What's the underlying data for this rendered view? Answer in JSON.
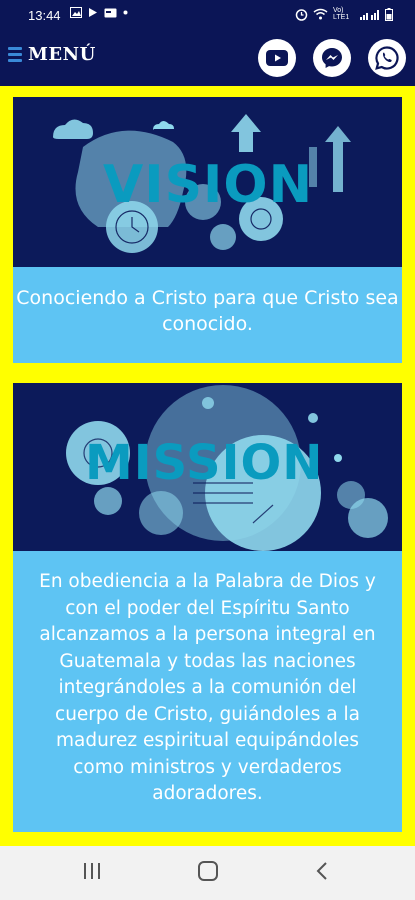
{
  "status_bar": {
    "time": "13:44",
    "signal_text": "Vo) LTE1"
  },
  "app_bar": {
    "menu_label": "MENÚ",
    "buttons": [
      {
        "name": "youtube-button",
        "icon": "youtube-icon"
      },
      {
        "name": "messenger-button",
        "icon": "messenger-icon"
      },
      {
        "name": "whatsapp-button",
        "icon": "whatsapp-icon"
      }
    ]
  },
  "cards": [
    {
      "banner_title": "VISION",
      "text": "Conociendo a Cristo para que Cristo sea conocido."
    },
    {
      "banner_title": "MISSION",
      "text": "En obediencia a la Palabra de Dios y con el poder del Espíritu Santo alcanzamos a la persona integral en Guatemala y todas las naciones integrándoles a la comunión del cuerpo de Cristo, guiándoles a la madurez espiritual equipándoles como ministros y verdaderos adoradores."
    }
  ],
  "colors": {
    "navy": "#0b1556",
    "frame": "#ffff00",
    "panel": "#5ec4f3",
    "illustration": "#8fd8ec",
    "accent": "#0a9bbf"
  }
}
